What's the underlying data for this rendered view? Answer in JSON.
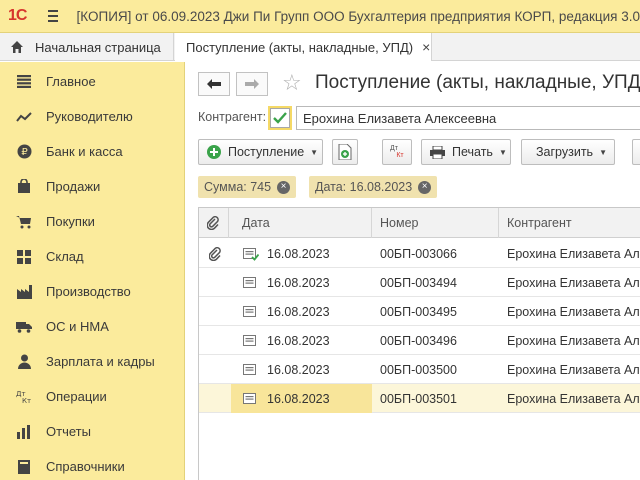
{
  "app": {
    "logo_text": "1С",
    "title": "[КОПИЯ] от 06.09.2023 Джи Пи Групп ООО Бухгалтерия предприятия КОРП, редакция 3.0"
  },
  "tabs": {
    "home": "Начальная страница",
    "active_doc": "Поступление (акты, накладные, УПД)",
    "close_glyph": "×"
  },
  "sidebar": {
    "items": [
      {
        "label": "Главное",
        "icon": "menu-lines-icon"
      },
      {
        "label": "Руководителю",
        "icon": "trend-chart-icon"
      },
      {
        "label": "Банк и касса",
        "icon": "ruble-coin-icon"
      },
      {
        "label": "Продажи",
        "icon": "shopping-bag-icon"
      },
      {
        "label": "Покупки",
        "icon": "shopping-cart-icon"
      },
      {
        "label": "Склад",
        "icon": "warehouse-icon"
      },
      {
        "label": "Производство",
        "icon": "factory-icon"
      },
      {
        "label": "ОС и НМА",
        "icon": "truck-icon"
      },
      {
        "label": "Зарплата и кадры",
        "icon": "person-icon"
      },
      {
        "label": "Операции",
        "icon": "dt-kt-icon"
      },
      {
        "label": "Отчеты",
        "icon": "bar-chart-icon"
      },
      {
        "label": "Справочники",
        "icon": "book-icon"
      }
    ]
  },
  "form": {
    "title": "Поступление (акты, накладные, УПД)",
    "counterparty_label": "Контрагент:",
    "counterparty_checked": true,
    "counterparty_value": "Ерохина Елизавета Алексеевна"
  },
  "toolbar": {
    "receipt_label": "Поступление",
    "dt_label": "Дт",
    "kt_label": "Кт",
    "print_label": "Печать",
    "load_label": "Загрузить"
  },
  "filters": [
    {
      "label": "Сумма: 745"
    },
    {
      "label": "Дата: 16.08.2023"
    }
  ],
  "table": {
    "columns": {
      "date": "Дата",
      "number": "Номер",
      "counterparty": "Контрагент"
    },
    "rows": [
      {
        "date": "16.08.2023",
        "number": "00БП-003066",
        "counterparty": "Ерохина Елизавета Ал",
        "has_attachment": true,
        "posted": true,
        "selected": false
      },
      {
        "date": "16.08.2023",
        "number": "00БП-003494",
        "counterparty": "Ерохина Елизавета Ал",
        "has_attachment": false,
        "posted": false,
        "selected": false
      },
      {
        "date": "16.08.2023",
        "number": "00БП-003495",
        "counterparty": "Ерохина Елизавета Ал",
        "has_attachment": false,
        "posted": false,
        "selected": false
      },
      {
        "date": "16.08.2023",
        "number": "00БП-003496",
        "counterparty": "Ерохина Елизавета Ал",
        "has_attachment": false,
        "posted": false,
        "selected": false
      },
      {
        "date": "16.08.2023",
        "number": "00БП-003500",
        "counterparty": "Ерохина Елизавета Ал",
        "has_attachment": false,
        "posted": false,
        "selected": false
      },
      {
        "date": "16.08.2023",
        "number": "00БП-003501",
        "counterparty": "Ерохина Елизавета Ал",
        "has_attachment": false,
        "posted": false,
        "selected": true
      }
    ]
  },
  "colors": {
    "sidebar_bg": "#fbeb9c",
    "accent_green": "#3aa34a",
    "selected_row": "#fcf6d9",
    "filter_bg": "#f0e2ae"
  }
}
